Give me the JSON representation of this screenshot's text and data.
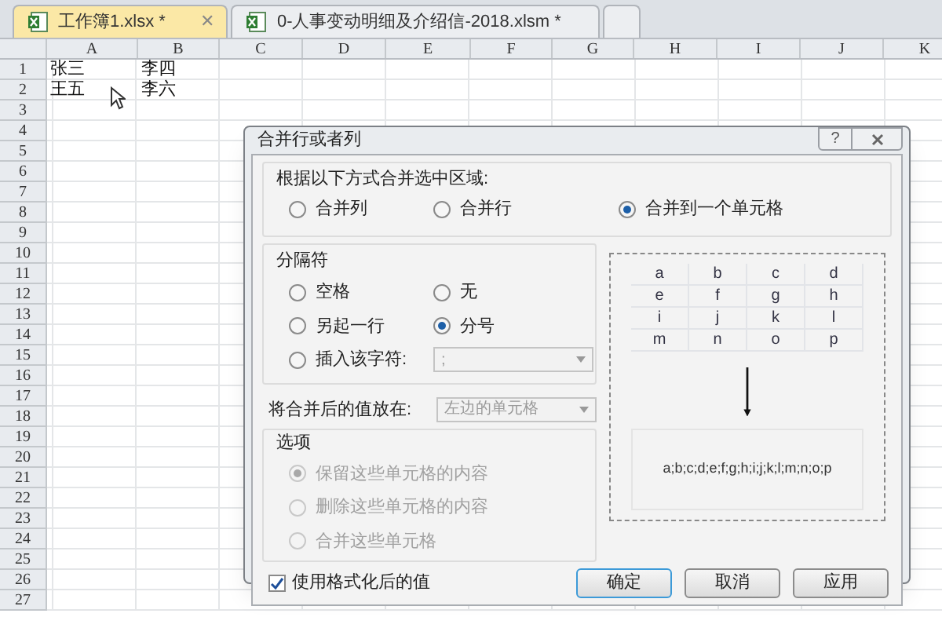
{
  "tabs": [
    {
      "kind": "document",
      "label": "工作簿1.xlsx *",
      "selected": true,
      "close_glyph": "✕"
    },
    {
      "kind": "document",
      "label": "0-人事变动明细及介绍信-2018.xlsm *",
      "selected": false
    },
    {
      "kind": "new",
      "selected": false
    }
  ],
  "sheet": {
    "columns": [
      "A",
      "B",
      "C",
      "D",
      "E",
      "F",
      "G",
      "H",
      "I",
      "J",
      "K"
    ],
    "rows": [
      {
        "number": "1",
        "cells": [
          "张三",
          "李四"
        ]
      },
      {
        "number": "2",
        "cells": [
          "王五",
          "李六"
        ]
      },
      {
        "number": "3",
        "cells": []
      },
      {
        "number": "4",
        "cells": []
      },
      {
        "number": "5",
        "cells": []
      },
      {
        "number": "6",
        "cells": []
      },
      {
        "number": "7",
        "cells": []
      },
      {
        "number": "8",
        "cells": []
      },
      {
        "number": "9",
        "cells": []
      },
      {
        "number": "10",
        "cells": []
      },
      {
        "number": "11",
        "cells": []
      },
      {
        "number": "12",
        "cells": []
      },
      {
        "number": "13",
        "cells": []
      },
      {
        "number": "14",
        "cells": []
      },
      {
        "number": "15",
        "cells": []
      },
      {
        "number": "16",
        "cells": []
      },
      {
        "number": "17",
        "cells": []
      },
      {
        "number": "18",
        "cells": []
      },
      {
        "number": "19",
        "cells": []
      },
      {
        "number": "20",
        "cells": []
      },
      {
        "number": "21",
        "cells": []
      },
      {
        "number": "22",
        "cells": []
      },
      {
        "number": "23",
        "cells": []
      },
      {
        "number": "24",
        "cells": []
      },
      {
        "number": "25",
        "cells": []
      },
      {
        "number": "26",
        "cells": []
      },
      {
        "number": "27",
        "cells": []
      }
    ]
  },
  "dialog": {
    "title": "合并行或者列",
    "help_glyph": "?",
    "merge_group": {
      "label": "根据以下方式合并选中区域:",
      "options": [
        {
          "label": "合并列",
          "selected": false
        },
        {
          "label": "合并行",
          "selected": false
        },
        {
          "label": "合并到一个单元格",
          "selected": true
        }
      ]
    },
    "separator_group": {
      "label": "分隔符",
      "options": [
        {
          "label": "空格",
          "selected": false
        },
        {
          "label": "无",
          "selected": false
        },
        {
          "label": "另起一行",
          "selected": false
        },
        {
          "label": "分号",
          "selected": true
        },
        {
          "label": "插入该字符:",
          "selected": false
        }
      ],
      "char_field": {
        "value": ";",
        "disabled": true
      }
    },
    "place_label": "将合并后的值放在:",
    "place_field": {
      "value": "左边的单元格",
      "disabled": true
    },
    "options_group": {
      "label": "选项",
      "options": [
        {
          "label": "保留这些单元格的内容",
          "selected": true,
          "disabled": true
        },
        {
          "label": "删除这些单元格的内容",
          "selected": false,
          "disabled": true
        },
        {
          "label": "合并这些单元格",
          "selected": false,
          "disabled": true
        }
      ]
    },
    "preview": {
      "grid": [
        [
          "a",
          "b",
          "c",
          "d"
        ],
        [
          "e",
          "f",
          "g",
          "h"
        ],
        [
          "i",
          "j",
          "k",
          "l"
        ],
        [
          "m",
          "n",
          "o",
          "p"
        ]
      ],
      "result": "a;b;c;d;e;f;g;h;i;j;k;l;m;n;o;p"
    },
    "format_checkbox": {
      "label": "使用格式化后的值",
      "checked": true
    },
    "buttons": [
      {
        "label": "确定",
        "default": true
      },
      {
        "label": "取消",
        "default": false
      },
      {
        "label": "应用",
        "default": false
      }
    ]
  }
}
